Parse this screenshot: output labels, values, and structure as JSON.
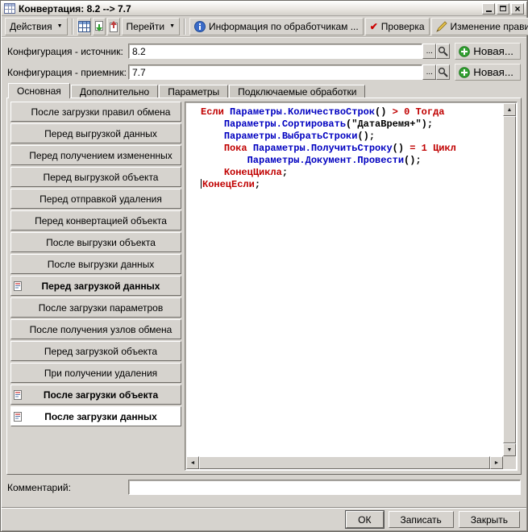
{
  "window": {
    "title": "Конвертация: 8.2 --> 7.7"
  },
  "icons": {
    "dropdown": "▼",
    "close": "×",
    "check": "✔",
    "ellipsis": "...",
    "scroll_up": "▲",
    "scroll_down": "▼",
    "scroll_left": "◄",
    "scroll_right": "►"
  },
  "toolbar": {
    "actions_label": "Действия",
    "goto_label": "Перейти",
    "handlers_info_label": "Информация по обработчикам ...",
    "check_label": "Проверка",
    "change_rules_label": "Изменение правил"
  },
  "fields": {
    "source": {
      "label": "Конфигурация - источник:",
      "value": "8.2",
      "new_label": "Новая..."
    },
    "target": {
      "label": "Конфигурация - приемник:",
      "value": "7.7",
      "new_label": "Новая..."
    }
  },
  "tabs": {
    "items": [
      {
        "label": "Основная",
        "active": true
      },
      {
        "label": "Дополнительно",
        "active": false
      },
      {
        "label": "Параметры",
        "active": false
      },
      {
        "label": "Подключаемые обработки",
        "active": false
      }
    ]
  },
  "handlers": {
    "items": [
      {
        "label": "После загрузки правил обмена",
        "has_icon": false,
        "selected": false
      },
      {
        "label": "Перед выгрузкой данных",
        "has_icon": false,
        "selected": false
      },
      {
        "label": "Перед получением измененных",
        "has_icon": false,
        "selected": false
      },
      {
        "label": "Перед выгрузкой объекта",
        "has_icon": false,
        "selected": false
      },
      {
        "label": "Перед отправкой удаления",
        "has_icon": false,
        "selected": false
      },
      {
        "label": "Перед конвертацией объекта",
        "has_icon": false,
        "selected": false
      },
      {
        "label": "После выгрузки объекта",
        "has_icon": false,
        "selected": false
      },
      {
        "label": "После выгрузки данных",
        "has_icon": false,
        "selected": false
      },
      {
        "label": "Перед загрузкой данных",
        "has_icon": true,
        "selected": false
      },
      {
        "label": "После загрузки параметров",
        "has_icon": false,
        "selected": false
      },
      {
        "label": "После получения узлов обмена",
        "has_icon": false,
        "selected": false
      },
      {
        "label": "Перед загрузкой объекта",
        "has_icon": false,
        "selected": false
      },
      {
        "label": "При получении удаления",
        "has_icon": false,
        "selected": false
      },
      {
        "label": "После загрузки объекта",
        "has_icon": true,
        "selected": false
      },
      {
        "label": "После загрузки данных",
        "has_icon": true,
        "selected": true
      }
    ]
  },
  "code": {
    "colors": {
      "kw": "#c00000",
      "id": "#0000c0",
      "pl": "#000000",
      "op": "#c00000",
      "num": "#c00000",
      "str": "#000000"
    },
    "lines": [
      {
        "tokens": [
          {
            "t": "Если ",
            "c": "kw"
          },
          {
            "t": "Параметры.КоличествоСтрок",
            "c": "id"
          },
          {
            "t": "() ",
            "c": "pl"
          },
          {
            "t": "> ",
            "c": "op"
          },
          {
            "t": "0 ",
            "c": "num"
          },
          {
            "t": "Тогда",
            "c": "kw"
          }
        ]
      },
      {
        "tokens": [
          {
            "t": "    ",
            "c": "pl"
          },
          {
            "t": "Параметры.Сортировать",
            "c": "id"
          },
          {
            "t": "(",
            "c": "pl"
          },
          {
            "t": "\"ДатаВремя+\"",
            "c": "str"
          },
          {
            "t": ");",
            "c": "pl"
          }
        ]
      },
      {
        "tokens": [
          {
            "t": "    ",
            "c": "pl"
          },
          {
            "t": "Параметры.ВыбратьСтроки",
            "c": "id"
          },
          {
            "t": "();",
            "c": "pl"
          }
        ]
      },
      {
        "tokens": [
          {
            "t": "    ",
            "c": "pl"
          },
          {
            "t": "Пока ",
            "c": "kw"
          },
          {
            "t": "Параметры.ПолучитьСтроку",
            "c": "id"
          },
          {
            "t": "() ",
            "c": "pl"
          },
          {
            "t": "= ",
            "c": "op"
          },
          {
            "t": "1 ",
            "c": "num"
          },
          {
            "t": "Цикл",
            "c": "kw"
          }
        ]
      },
      {
        "tokens": [
          {
            "t": "        ",
            "c": "pl"
          },
          {
            "t": "Параметры.Документ.Провести",
            "c": "id"
          },
          {
            "t": "();",
            "c": "pl"
          }
        ]
      },
      {
        "tokens": [
          {
            "t": "    ",
            "c": "pl"
          },
          {
            "t": "КонецЦикла",
            "c": "kw"
          },
          {
            "t": ";",
            "c": "pl"
          }
        ]
      },
      {
        "tokens": [
          {
            "caret": true
          },
          {
            "t": "КонецЕсли",
            "c": "kw"
          },
          {
            "t": ";",
            "c": "pl"
          }
        ]
      }
    ]
  },
  "comment": {
    "label": "Комментарий:",
    "value": ""
  },
  "footer": {
    "ok_label": "ОК",
    "save_label": "Записать",
    "close_label": "Закрыть"
  }
}
